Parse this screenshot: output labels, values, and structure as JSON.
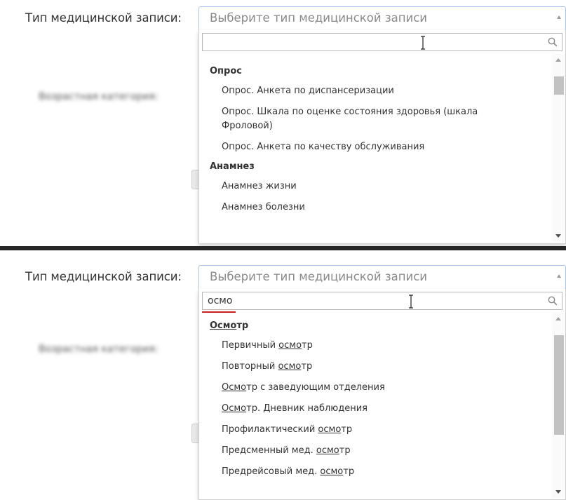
{
  "top": {
    "field_label": "Тип медицинской записи:",
    "blurred_label": "Возрастная категория:",
    "placeholder": "Выберите тип медицинской записи",
    "search_value": "",
    "groups": [
      {
        "header": "Опрос",
        "options": [
          "Опрос. Анкета по диспансеризации",
          "Опрос. Шкала по оценке состояния здоровья (шкала Фроловой)",
          "Опрос. Анкета по качеству обслуживания"
        ]
      },
      {
        "header": "Анамнез",
        "options": [
          "Анамнез жизни",
          "Анамнез болезни"
        ]
      }
    ]
  },
  "bottom": {
    "field_label": "Тип медицинской записи:",
    "blurred_label": "Возрастная категория:",
    "placeholder": "Выберите тип медицинской записи",
    "search_value": "осмо",
    "groups": [
      {
        "header": {
          "match": "Осмо",
          "rest": "тр"
        },
        "options": [
          {
            "before": "Первичный ",
            "match": "осмо",
            "after": "тр"
          },
          {
            "before": "Повторный ",
            "match": "осмо",
            "after": "тр"
          },
          {
            "before": "",
            "match": "Осмо",
            "after": "тр с заведующим отделения"
          },
          {
            "before": "",
            "match": "Осмо",
            "after": "тр. Дневник наблюдения"
          },
          {
            "before": "Профилактический ",
            "match": "осмо",
            "after": "тр"
          },
          {
            "before": "Предсменный мед. ",
            "match": "осмо",
            "after": "тр"
          },
          {
            "before": "Предрейсовый мед. ",
            "match": "осмо",
            "after": "тр"
          }
        ]
      }
    ]
  },
  "colors": {
    "select_border": "#a8c4e6",
    "separator": "#262626",
    "search_underline": "#cc2020"
  },
  "icons": {
    "search": "magnifier-icon",
    "cursor": "text-cursor-icon",
    "scroll_up": "scroll-up-arrow-icon",
    "scroll_down": "scroll-down-arrow-icon"
  }
}
